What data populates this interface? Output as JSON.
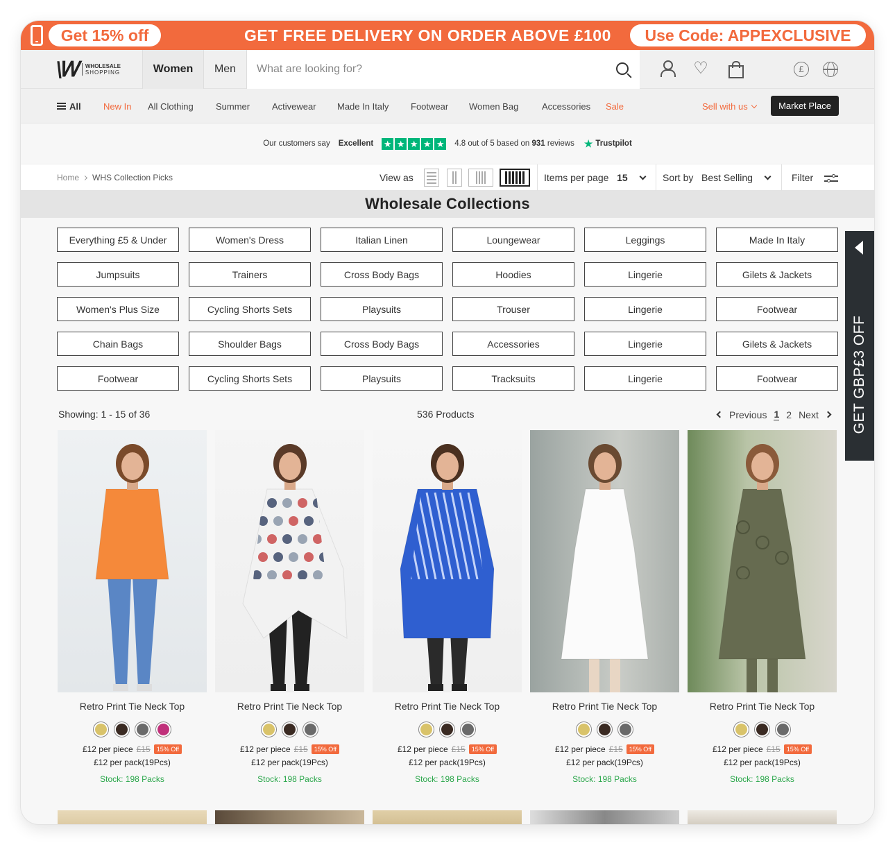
{
  "promo": {
    "left_pill": "Get 15% off",
    "middle": "GET FREE DELIVERY ON ORDER ABOVE £100",
    "right_pill": "Use Code: APPEXCLUSIVE"
  },
  "header": {
    "logo_line1": "WHOLESALE",
    "logo_line2": "SHOPPING",
    "tabs": [
      {
        "label": "Women"
      },
      {
        "label": "Men"
      }
    ],
    "search_placeholder": "What are looking for?",
    "currency_symbol": "£"
  },
  "nav": {
    "all": "All",
    "items": [
      "New In",
      "All Clothing",
      "Summer",
      "Activewear",
      "Made In Italy",
      "Footwear",
      "Women Bag",
      "Accessories",
      "Sale"
    ],
    "sell": "Sell with us",
    "market": "Market Place"
  },
  "trust": {
    "prefix": "Our customers say",
    "rating_word": "Excellent",
    "score_text": "4.8 out of 5 based on",
    "reviews": "931",
    "reviews_suffix": "reviews",
    "brand": "Trustpilot",
    "star_glyph": "★"
  },
  "toolbar": {
    "breadcrumb": [
      "Home",
      "WHS Collection Picks"
    ],
    "view_as": "View as",
    "items_per_page": "Items per page",
    "items_value": "15",
    "sort_by": "Sort by",
    "sort_value": "Best Selling",
    "filter": "Filter"
  },
  "collections": {
    "title": "Wholesale Collections",
    "buttons": [
      "Everything £5 & Under",
      "Women's Dress",
      "Italian Linen",
      "Loungewear",
      "Leggings",
      "Made In Italy",
      "Jumpsuits",
      "Trainers",
      "Cross Body Bags",
      "Hoodies",
      "Lingerie",
      "Gilets & Jackets",
      "Women's Plus Size",
      "Cycling Shorts Sets",
      "Playsuits",
      "Trouser",
      "Lingerie",
      "Footwear",
      "Chain Bags",
      "Shoulder Bags",
      "Cross Body Bags",
      "Accessories",
      "Lingerie",
      "Gilets & Jackets",
      "Footwear",
      "Cycling Shorts Sets",
      "Playsuits",
      "Tracksuits",
      "Lingerie",
      "Footwear"
    ]
  },
  "side_tab": "GET GBP£3 OFF",
  "listing": {
    "showing": "Showing: 1 - 15 of 36",
    "products_count": "536 Products",
    "previous": "Previous",
    "pages": [
      "1",
      "2"
    ],
    "next": "Next"
  },
  "products": [
    {
      "title": "Retro Print Tie Neck Top",
      "price": "£12 per piece",
      "old": "£15",
      "badge": "15% Off",
      "pack": "£12 per pack(19Pcs)",
      "stock": "Stock: 198 Packs",
      "swatches": [
        "#d9c36a",
        "#3a2a22",
        "#6a6a6a",
        "#c0307a"
      ]
    },
    {
      "title": "Retro Print Tie Neck Top",
      "price": "£12 per piece",
      "old": "£15",
      "badge": "15% Off",
      "pack": "£12 per pack(19Pcs)",
      "stock": "Stock: 198 Packs",
      "swatches": [
        "#d9c36a",
        "#3a2a22",
        "#6a6a6a"
      ]
    },
    {
      "title": "Retro Print Tie Neck Top",
      "price": "£12 per piece",
      "old": "£15",
      "badge": "15% Off",
      "pack": "£12 per pack(19Pcs)",
      "stock": "Stock: 198 Packs",
      "swatches": [
        "#d9c36a",
        "#3a2a22",
        "#6a6a6a"
      ]
    },
    {
      "title": "Retro Print Tie Neck Top",
      "price": "£12 per piece",
      "old": "£15",
      "badge": "15% Off",
      "pack": "£12 per pack(19Pcs)",
      "stock": "Stock: 198 Packs",
      "swatches": [
        "#d9c36a",
        "#3a2a22",
        "#6a6a6a"
      ]
    },
    {
      "title": "Retro Print Tie Neck Top",
      "price": "£12 per piece",
      "old": "£15",
      "badge": "15% Off",
      "pack": "£12 per pack(19Pcs)",
      "stock": "Stock: 198 Packs",
      "swatches": [
        "#d9c36a",
        "#3a2a22",
        "#6a6a6a"
      ]
    }
  ],
  "colors": {
    "accent": "#f26a3d",
    "stock_green": "#2aa64a",
    "trust_green": "#00b67a",
    "dark": "#2a2f33"
  }
}
